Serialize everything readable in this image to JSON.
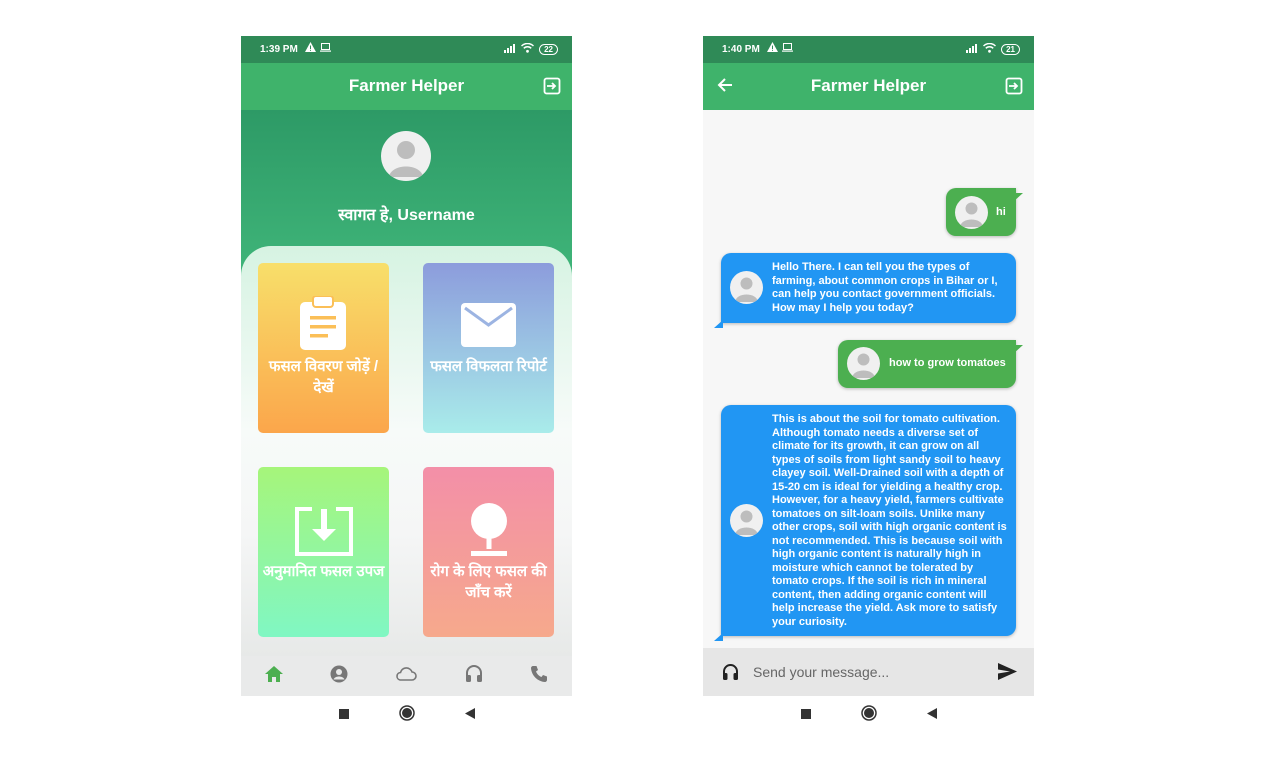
{
  "home": {
    "status": {
      "time": "1:39 PM",
      "battery": "22"
    },
    "appbar": {
      "title": "Farmer Helper"
    },
    "welcome": "स्वागत हे, Username",
    "cards": [
      {
        "label": "फसल विवरण जोड़ें / देखें",
        "icon": "clipboard-icon"
      },
      {
        "label": "फसल विफलता रिपोर्ट",
        "icon": "mail-icon"
      },
      {
        "label": "अनुमानित फसल उपज",
        "icon": "download-icon"
      },
      {
        "label": "रोग के लिए फसल की जाँच करें",
        "icon": "pin-icon"
      }
    ],
    "bottom_nav": [
      "home-icon",
      "account-icon",
      "cloud-icon",
      "headset-icon",
      "phone-icon"
    ],
    "colors": {
      "appbar": "#3fb36b",
      "active_nav": "#4caf50"
    }
  },
  "chat": {
    "status": {
      "time": "1:40 PM",
      "battery": "21"
    },
    "appbar": {
      "title": "Farmer Helper"
    },
    "messages": [
      {
        "from": "user",
        "text": "hi"
      },
      {
        "from": "bot",
        "text": "Hello There. I can tell you the types of farming, about common crops in Bihar or I, can help you contact government officials. How may I help you today?"
      },
      {
        "from": "user",
        "text": "how to grow tomatoes"
      },
      {
        "from": "bot",
        "text": "This is about the soil for tomato cultivation. Although tomato needs a diverse set of climate for its growth, it can grow on all types of soils from light sandy soil to heavy clayey soil. Well-Drained soil with a depth of 15-20 cm is ideal for yielding a healthy crop. However, for a heavy yield, farmers cultivate tomatoes on silt-loam soils. Unlike many other crops, soil with high organic content is not recommended. This is because soil with high organic content is naturally high in moisture which cannot be tolerated by tomato crops. If the soil is rich in mineral content, then adding organic content will help increase the yield. Ask more to satisfy your curiosity."
      }
    ],
    "composer": {
      "placeholder": "Send your message..."
    },
    "colors": {
      "user_bubble": "#4caf50",
      "bot_bubble": "#2196f3"
    }
  }
}
